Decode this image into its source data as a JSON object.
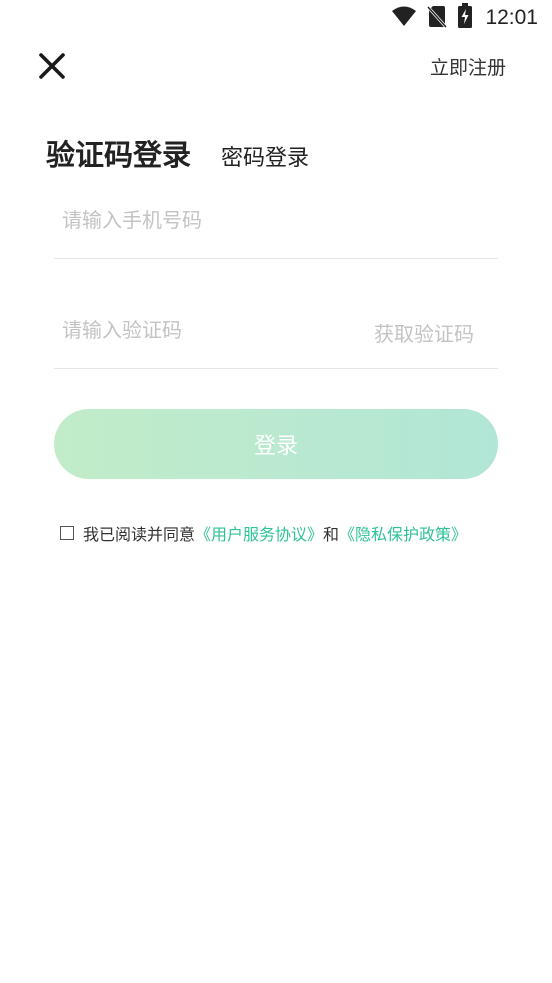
{
  "status_bar": {
    "time": "12:01",
    "icons": [
      "wifi-icon",
      "no-sim-icon",
      "battery-charging-icon"
    ]
  },
  "header": {
    "close_icon": "close-icon",
    "register_label": "立即注册"
  },
  "tabs": {
    "active": "验证码登录",
    "inactive": "密码登录"
  },
  "form": {
    "phone_placeholder": "请输入手机号码",
    "code_placeholder": "请输入验证码",
    "get_code_label": "获取验证码",
    "login_label": "登录"
  },
  "agreement": {
    "prefix": "我已阅读并同意",
    "user_agreement": "《用户服务协议》",
    "conjunction": "和",
    "privacy_policy": "《隐私保护政策》",
    "checked": false
  },
  "colors": {
    "accent_link": "#2fc29a",
    "button_gradient_start": "#c2ecc9",
    "button_gradient_end": "#b1e6d6",
    "placeholder": "#c3c3c3"
  }
}
